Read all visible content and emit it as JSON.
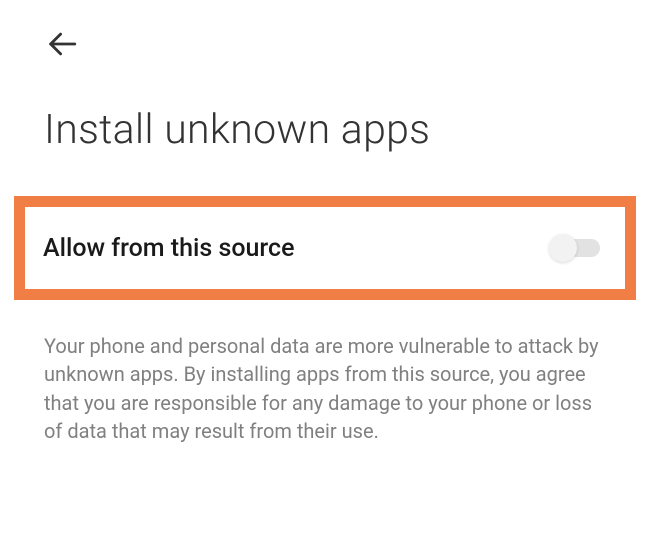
{
  "header": {
    "page_title": "Install unknown apps"
  },
  "setting": {
    "label": "Allow from this source",
    "toggle_state": "off"
  },
  "warning": {
    "text": "Your phone and personal data are more vulnerable to attack by unknown apps. By installing apps from this source, you agree that you are responsible for any damage to your phone or loss of data that may result from their use."
  }
}
